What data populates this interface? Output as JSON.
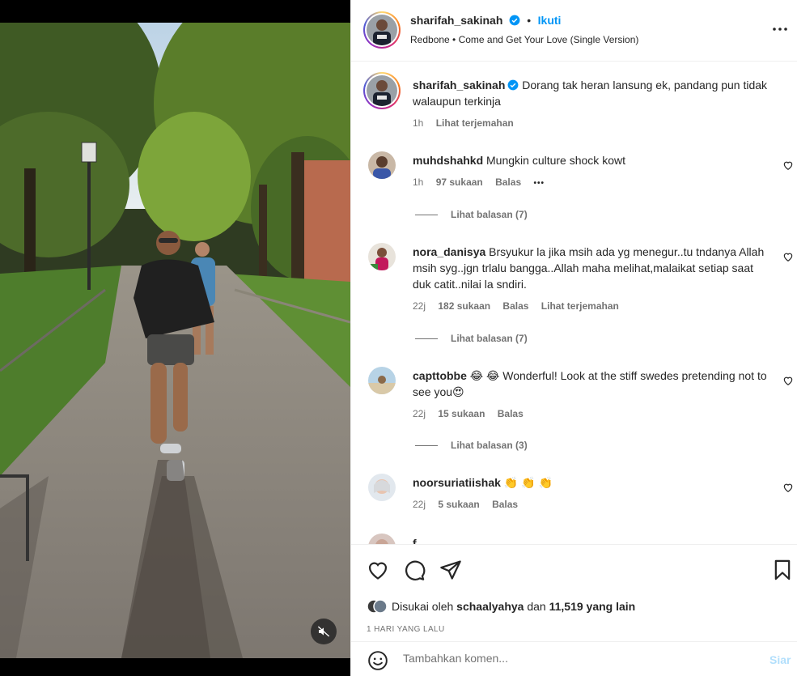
{
  "post": {
    "author": "sharifah_sakinah",
    "follow_label": "Ikuti",
    "dot": "•",
    "song": "Redbone • Come and Get Your Love (Single Version)",
    "caption": "Dorang tak heran lansung ek, pandang pun tidak walaupun terkinja",
    "caption_time": "1h",
    "caption_translate": "Lihat terjemahan"
  },
  "comments": [
    {
      "user": "muhdshahkd",
      "text": "Mungkin culture shock kowt",
      "time": "1h",
      "likes": "97 sukaan",
      "reply": "Balas",
      "more": "•••",
      "replies": "Lihat balasan (7)"
    },
    {
      "user": "nora_danisya",
      "text": "Brsyukur la jika msih ada yg menegur..tu tndanya Allah msih syg..jgn trlalu bangga..Allah maha melihat,malaikat setiap saat duk catit..nilai la sndiri.",
      "time": "22j",
      "likes": "182 sukaan",
      "reply": "Balas",
      "translate": "Lihat terjemahan",
      "replies": "Lihat balasan (7)"
    },
    {
      "user": "capttobbe",
      "text": "😂 😂 Wonderful! Look at the stiff swedes pretending not to see you😍",
      "time": "22j",
      "likes": "15 sukaan",
      "reply": "Balas",
      "replies": "Lihat balasan (3)"
    },
    {
      "user": "noorsuriatiishak",
      "text": "👏 👏 👏",
      "time": "22j",
      "likes": "5 sukaan",
      "reply": "Balas"
    },
    {
      "user": "f",
      "text": ""
    }
  ],
  "footer": {
    "liked_by_prefix": "Disukai oleh",
    "liked_by_user": "schaalyahya",
    "liked_by_and": "dan",
    "liked_by_rest": "11,519 yang lain",
    "time_ago": "1 HARI YANG LALU",
    "comment_placeholder": "Tambahkan komen...",
    "post_label": "Siar"
  },
  "icons": {
    "like": "heart-icon",
    "comment": "comment-icon",
    "share": "share-icon",
    "save": "bookmark-icon",
    "more": "more-icon",
    "emoji": "emoji-icon",
    "mute": "muted-speaker-icon",
    "verified": "verified-badge-icon"
  },
  "colors": {
    "accent": "#0095f6",
    "post_disabled": "#b2dffc",
    "secondary_text": "#737373"
  }
}
